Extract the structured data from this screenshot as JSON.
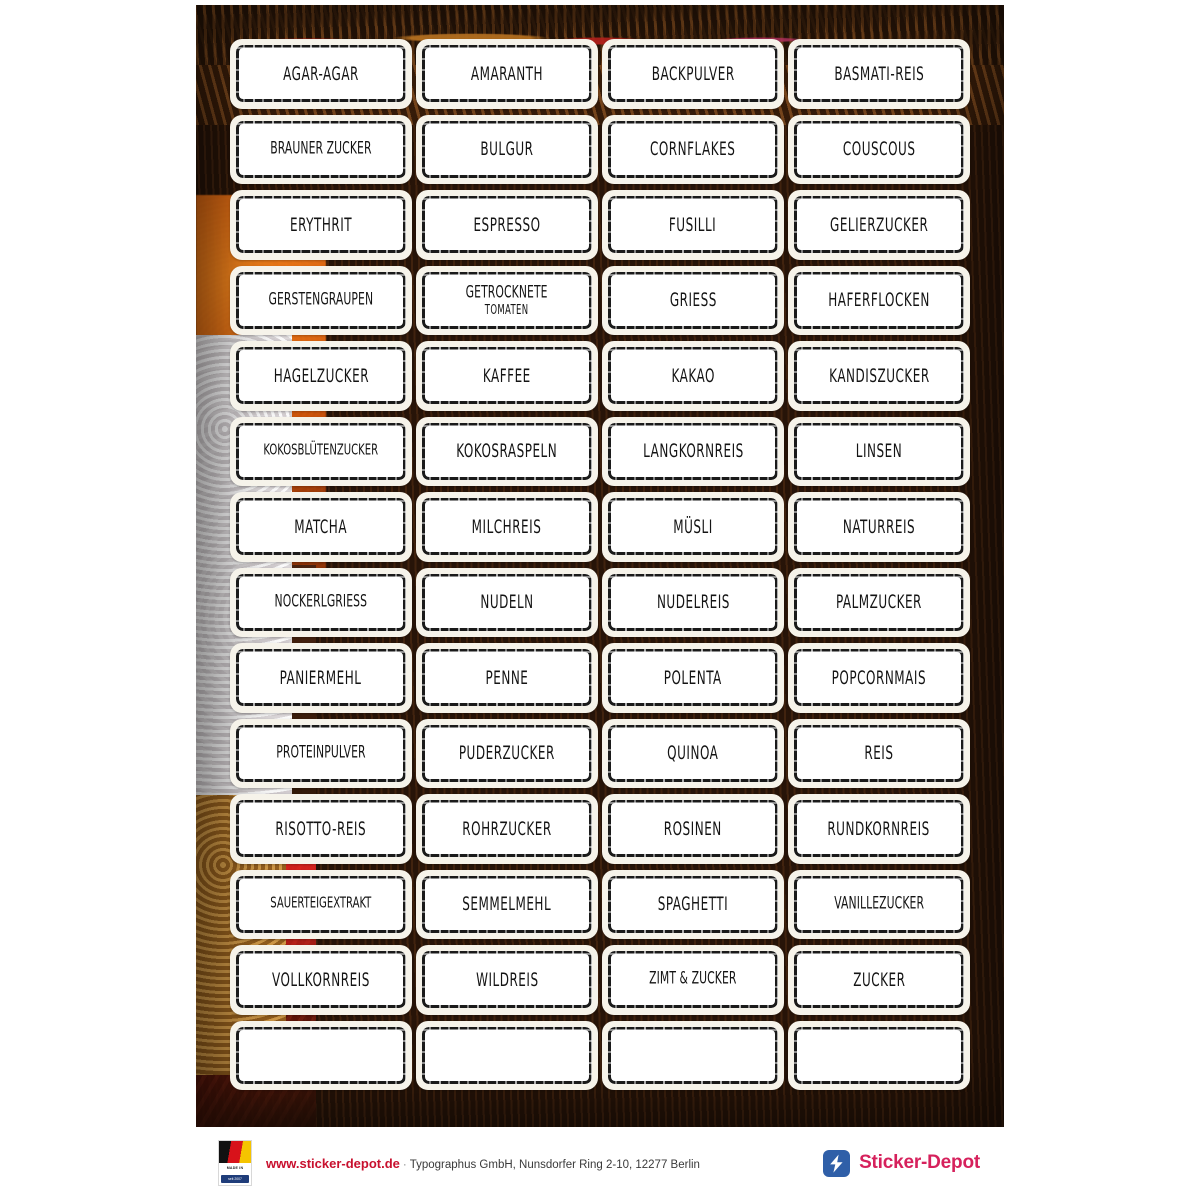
{
  "sheet": {
    "columns": 4,
    "rows": 14,
    "labels": [
      "AGAR-AGAR",
      "AMARANTH",
      "BACKPULVER",
      "BASMATI-REIS",
      "BRAUNER ZUCKER",
      "BULGUR",
      "CORNFLAKES",
      "COUSCOUS",
      "ERYTHRIT",
      "ESPRESSO",
      "FUSILLI",
      "GELIERZUCKER",
      "GERSTENGRAUPEN",
      "GETROCKNETE|TOMATEN",
      "GRIESS",
      "HAFERFLOCKEN",
      "HAGELZUCKER",
      "KAFFEE",
      "KAKAO",
      "KANDISZUCKER",
      "KOKOSBLÜTENZUCKER",
      "KOKOSRASPELN",
      "LANGKORNREIS",
      "LINSEN",
      "MATCHA",
      "MILCHREIS",
      "MÜSLI",
      "NATURREIS",
      "NOCKERLGRIESS",
      "NUDELN",
      "NUDELREIS",
      "PALMZUCKER",
      "PANIERMEHL",
      "PENNE",
      "POLENTA",
      "POPCORNMAIS",
      "PROTEINPULVER",
      "PUDERZUCKER",
      "QUINOA",
      "REIS",
      "RISOTTO-REIS",
      "ROHRZUCKER",
      "ROSINEN",
      "RUNDKORNREIS",
      "SAUERTEIGEXTRAKT",
      "SEMMELMEHL",
      "SPAGHETTI",
      "VANILLEZUCKER",
      "VOLLKORNREIS",
      "WILDREIS",
      "ZIMT & ZUCKER",
      "ZUCKER",
      "",
      "",
      "",
      ""
    ]
  },
  "footer": {
    "flag_badge": {
      "caption": "MADE IN GERMANY",
      "bar_text": "seit 2007"
    },
    "url": "www.sticker-depot.de",
    "separator": "·",
    "company": "Typographus GmbH, Nunsdorfer Ring 2-10, 12277 Berlin",
    "brand_name": "Sticker-Depot",
    "brand_icon": "lightning-bolt-icon"
  },
  "colors": {
    "brand_pink": "#d6215c",
    "brand_blue": "#2f5fa8",
    "url_red": "#c8102e",
    "label_backing": "#f6f3ea",
    "label_border": "#1a1a1a"
  }
}
